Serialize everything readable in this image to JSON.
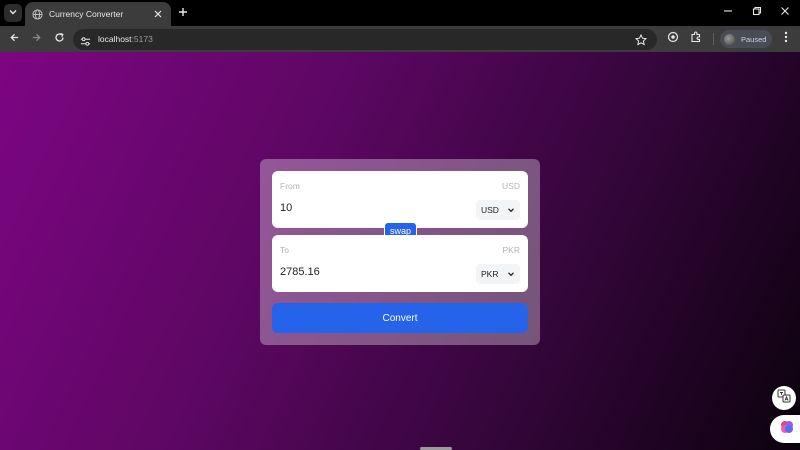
{
  "browser": {
    "tab": {
      "title": "Currency Converter"
    },
    "address": {
      "host": "localhost",
      "port": ":5173"
    },
    "profile": {
      "status": "Paused"
    }
  },
  "icons": {
    "tab_list": "chevron-down-icon",
    "favicon": "globe-icon",
    "tab_close": "close-icon",
    "new_tab": "plus-icon",
    "minimize": "minimize-icon",
    "restore": "restore-icon",
    "close_window": "close-icon",
    "back": "back-arrow-icon",
    "forward": "forward-arrow-icon",
    "reload": "reload-icon",
    "site_info": "site-info-icon",
    "bookmark": "star-icon",
    "lens": "lens-icon",
    "extensions": "puzzle-icon",
    "menu": "kebab-menu-icon"
  },
  "converter": {
    "from": {
      "label": "From",
      "currency_label": "USD",
      "amount": "10",
      "selected": "USD"
    },
    "to": {
      "label": "To",
      "currency_label": "PKR",
      "amount": "2785.16",
      "selected": "PKR"
    },
    "swap_label": "swap",
    "convert_label": "Convert"
  },
  "colors": {
    "accent": "#2563eb",
    "background_start": "#7d0583",
    "background_end": "#0c020e"
  }
}
